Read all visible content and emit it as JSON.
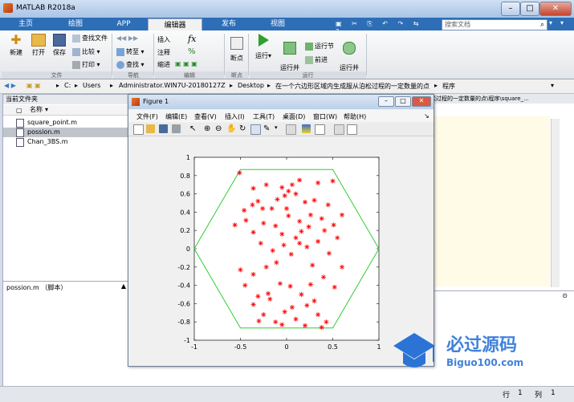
{
  "window": {
    "title": "MATLAB R2018a",
    "search_placeholder": "搜索文档"
  },
  "tabs": [
    "主页",
    "绘图",
    "APP",
    "编辑器",
    "发布",
    "视图"
  ],
  "active_tab": 3,
  "ribbon": {
    "new": "新建",
    "open": "打开",
    "save": "保存",
    "find_file": "查找文件",
    "compare": "比较",
    "print": "打印",
    "insert": "插入",
    "comment": "注释",
    "indent": "缩进",
    "goto": "转至",
    "find": "查找",
    "fx": "fx",
    "breakpoints": "断点",
    "run": "运行",
    "run_advance": "运行并\n前进",
    "run_section": "运行节",
    "advance": "前进",
    "run_time": "运行并\n计时",
    "groups": [
      "文件",
      "导航",
      "编辑",
      "断点",
      "运行"
    ]
  },
  "address": {
    "parts": [
      "C:",
      "Users",
      "Administrator.WIN7U-20180127Z",
      "Desktop",
      "在一个六边形区域内生成服从泊松过程的一定数量的点",
      "程序"
    ]
  },
  "left_panel": {
    "header": "当前文件夹",
    "column": "名称",
    "files": [
      "square_point.m",
      "possion.m",
      "Chan_3BS.m"
    ],
    "selected": 1,
    "details": "possion.m （脚本）"
  },
  "editor_path": "松过程的一定数量的点\\程序\\square_...",
  "status": {
    "row_label": "行",
    "row": "1",
    "col_label": "列",
    "col": "1"
  },
  "figure": {
    "title": "Figure 1",
    "menu": [
      "文件(F)",
      "编辑(E)",
      "查看(V)",
      "插入(I)",
      "工具(T)",
      "桌面(D)",
      "窗口(W)",
      "帮助(H)"
    ]
  },
  "chart_data": {
    "type": "scatter",
    "xlim": [
      -1,
      1
    ],
    "ylim": [
      -1,
      1
    ],
    "xticks": [
      "-1",
      "-0.5",
      "0",
      "0.5",
      "1"
    ],
    "yticks": [
      "1",
      "0.8",
      "0.6",
      "0.4",
      "0.2",
      "0",
      "-0.2",
      "-0.4",
      "-0.6",
      "-0.8",
      "-1"
    ],
    "marker_color": "#ff0000",
    "hexagon_color": "#33cc33",
    "hexagon": [
      [
        -1,
        0
      ],
      [
        -0.5,
        0.866
      ],
      [
        0.5,
        0.866
      ],
      [
        1,
        0
      ],
      [
        0.5,
        -0.866
      ],
      [
        -0.5,
        -0.866
      ],
      [
        -1,
        0
      ]
    ],
    "points": [
      [
        -0.51,
        0.83
      ],
      [
        -0.36,
        0.66
      ],
      [
        -0.22,
        0.7
      ],
      [
        -0.05,
        0.67
      ],
      [
        0.06,
        0.7
      ],
      [
        0.14,
        0.75
      ],
      [
        0.34,
        0.72
      ],
      [
        0.5,
        0.74
      ],
      [
        -0.37,
        0.48
      ],
      [
        -0.31,
        0.52
      ],
      [
        -0.26,
        0.44
      ],
      [
        -0.16,
        0.44
      ],
      [
        -0.1,
        0.54
      ],
      [
        -0.02,
        0.58
      ],
      [
        0.02,
        0.63
      ],
      [
        0.1,
        0.6
      ],
      [
        0.2,
        0.51
      ],
      [
        0.3,
        0.53
      ],
      [
        0.45,
        0.48
      ],
      [
        -0.56,
        0.26
      ],
      [
        -0.44,
        0.31
      ],
      [
        -0.36,
        0.18
      ],
      [
        -0.25,
        0.28
      ],
      [
        -0.12,
        0.25
      ],
      [
        0.02,
        0.36
      ],
      [
        0.14,
        0.3
      ],
      [
        0.26,
        0.37
      ],
      [
        0.38,
        0.33
      ],
      [
        0.51,
        0.26
      ],
      [
        0.6,
        0.37
      ],
      [
        -0.5,
        -0.23
      ],
      [
        -0.36,
        -0.28
      ],
      [
        -0.22,
        -0.2
      ],
      [
        -0.11,
        -0.15
      ],
      [
        -0.03,
        0.04
      ],
      [
        0.1,
        0.12
      ],
      [
        0.22,
        0.02
      ],
      [
        0.34,
        0.08
      ],
      [
        0.46,
        -0.05
      ],
      [
        0.55,
        0.12
      ],
      [
        -0.45,
        -0.4
      ],
      [
        -0.31,
        -0.52
      ],
      [
        -0.2,
        -0.49
      ],
      [
        -0.07,
        -0.38
      ],
      [
        0.04,
        -0.41
      ],
      [
        0.16,
        -0.5
      ],
      [
        0.26,
        -0.39
      ],
      [
        0.4,
        -0.31
      ],
      [
        0.52,
        -0.42
      ],
      [
        -0.36,
        -0.61
      ],
      [
        -0.25,
        -0.72
      ],
      [
        -0.12,
        -0.8
      ],
      [
        -0.02,
        -0.69
      ],
      [
        0.1,
        -0.77
      ],
      [
        0.22,
        -0.62
      ],
      [
        0.34,
        -0.72
      ],
      [
        0.43,
        -0.8
      ],
      [
        -0.3,
        -0.79
      ],
      [
        -0.18,
        -0.55
      ],
      [
        -0.05,
        -0.83
      ],
      [
        0.06,
        -0.64
      ],
      [
        0.2,
        -0.84
      ],
      [
        0.38,
        -0.86
      ],
      [
        0.3,
        -0.57
      ],
      [
        -0.05,
        0.16
      ],
      [
        0.05,
        -0.06
      ],
      [
        0.16,
        0.19
      ],
      [
        0.28,
        -0.18
      ],
      [
        -0.15,
        -0.02
      ],
      [
        0.0,
        0.44
      ],
      [
        0.14,
        0.06
      ],
      [
        0.41,
        0.2
      ],
      [
        0.6,
        -0.2
      ],
      [
        -0.28,
        0.06
      ],
      [
        0.24,
        0.24
      ],
      [
        -0.46,
        0.42
      ]
    ]
  }
}
